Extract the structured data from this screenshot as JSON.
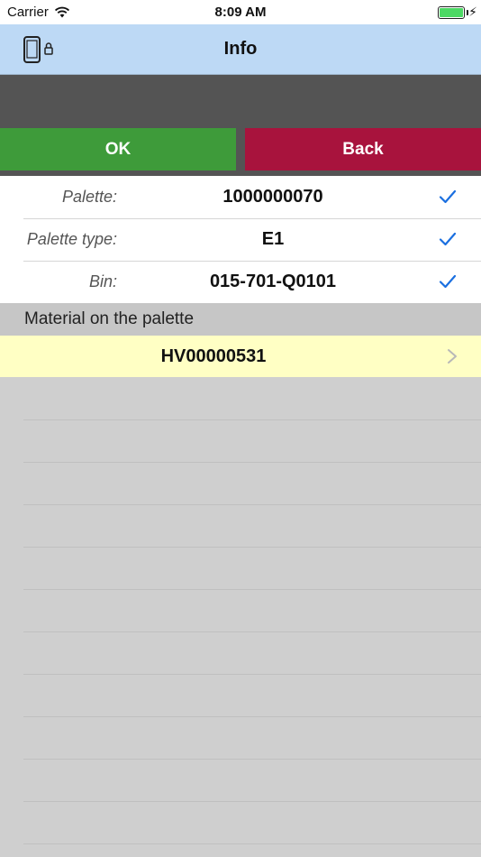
{
  "status_bar": {
    "carrier": "Carrier",
    "time": "8:09 AM",
    "battery_level": 1.0,
    "charging": true
  },
  "nav": {
    "title": "Info",
    "left_icon": "device-lock-icon",
    "background": "#bdd9f5"
  },
  "actions": {
    "ok_label": "OK",
    "back_label": "Back",
    "ok_color": "#3e9b3a",
    "back_color": "#a8133d"
  },
  "info_rows": [
    {
      "label": "Palette:",
      "value": "1000000070",
      "checked": true
    },
    {
      "label": "Palette type:",
      "value": "E1",
      "checked": true
    },
    {
      "label": "Bin:",
      "value": "015-701-Q0101",
      "checked": true
    }
  ],
  "materials": {
    "section_title": "Material on the palette",
    "items": [
      {
        "value": "HV00000531"
      }
    ],
    "highlight_color": "#ffffc4"
  }
}
